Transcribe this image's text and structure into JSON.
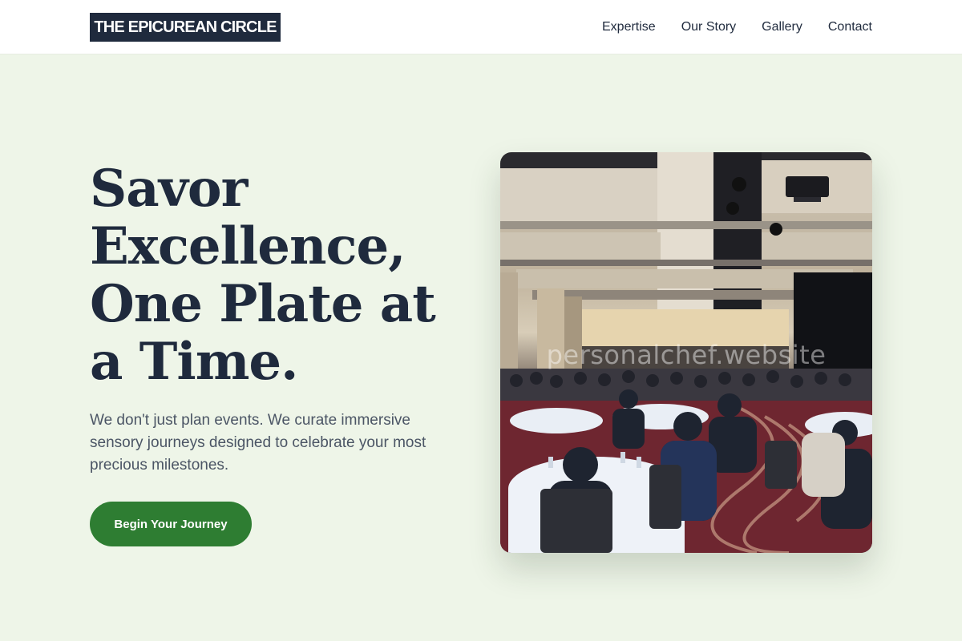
{
  "header": {
    "brand": "THE EPICUREAN CIRCLE",
    "nav": [
      "Expertise",
      "Our Story",
      "Gallery",
      "Contact"
    ]
  },
  "hero": {
    "title": "Savor Excellence, One Plate at a Time.",
    "subtitle": "We don't just plan events. We curate immersive sensory journeys designed to celebrate your most precious milestones.",
    "cta_label": "Begin Your Journey"
  },
  "image": {
    "subject": "banquet hall with round dining tables",
    "watermark": "personalchef.website"
  },
  "colors": {
    "page_bg": "#eef5e8",
    "brand_bg": "#1f2a3d",
    "accent": "#2e7d32",
    "text_dark": "#1f2a3d",
    "text_muted": "#4b5565"
  }
}
